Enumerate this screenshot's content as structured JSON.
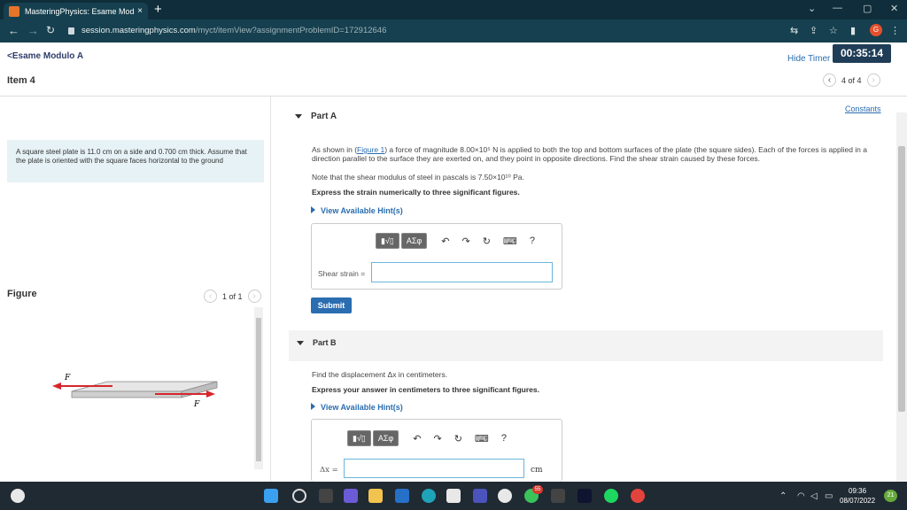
{
  "browser": {
    "tab_title": "MasteringPhysics: Esame Modul",
    "tab_close": "×",
    "new_tab": "+",
    "url_host": "session.masteringphysics.com",
    "url_path": "/myct/itemView?assignmentProblemID=172912646",
    "profile_initial": "G"
  },
  "header": {
    "back_label": "<Esame Modulo A",
    "hide_timer": "Hide Timer",
    "timer": "00:35:14",
    "item_title": "Item 4",
    "item_pager": "4 of 4"
  },
  "left": {
    "problem_text": "A square steel plate is 11.0 cm on a side and 0.700 cm thick. Assume that the plate is oriented with the square faces horizontal to the ground",
    "figure_title": "Figure",
    "figure_pager": "1 of 1",
    "force_label": "F"
  },
  "partA": {
    "constants": "Constants",
    "head": "Part A",
    "intro_1": "As shown in (",
    "figure_link": "Figure 1",
    "intro_2": ") a force of magnitude 8.00×10⁵ N is applied to both the top and bottom surfaces of the plate (the square sides). Each of the forces is applied in a direction parallel to the surface they are exerted on, and they point in opposite directions. Find the shear strain caused by these forces.",
    "note": "Note that the shear modulus of steel in pascals is 7.50×10¹⁰ Pa.",
    "instruction": "Express the strain numerically to three significant figures.",
    "hint": "View Available Hint(s)",
    "tb_template": "▮√▯",
    "tb_greek": "ΑΣφ",
    "field_label": "Shear strain =",
    "submit": "Submit"
  },
  "partB": {
    "head": "Part B",
    "question": "Find the displacement Δx in centimeters.",
    "instruction": "Express your answer in centimeters to three significant figures.",
    "hint": "View Available Hint(s)",
    "tb_template": "▮√▯",
    "tb_greek": "ΑΣφ",
    "field_label": "Δx =",
    "unit": "cm"
  },
  "taskbar": {
    "time": "09:36",
    "date": "08/07/2022",
    "notif_count": "21",
    "badge_count": "55"
  }
}
